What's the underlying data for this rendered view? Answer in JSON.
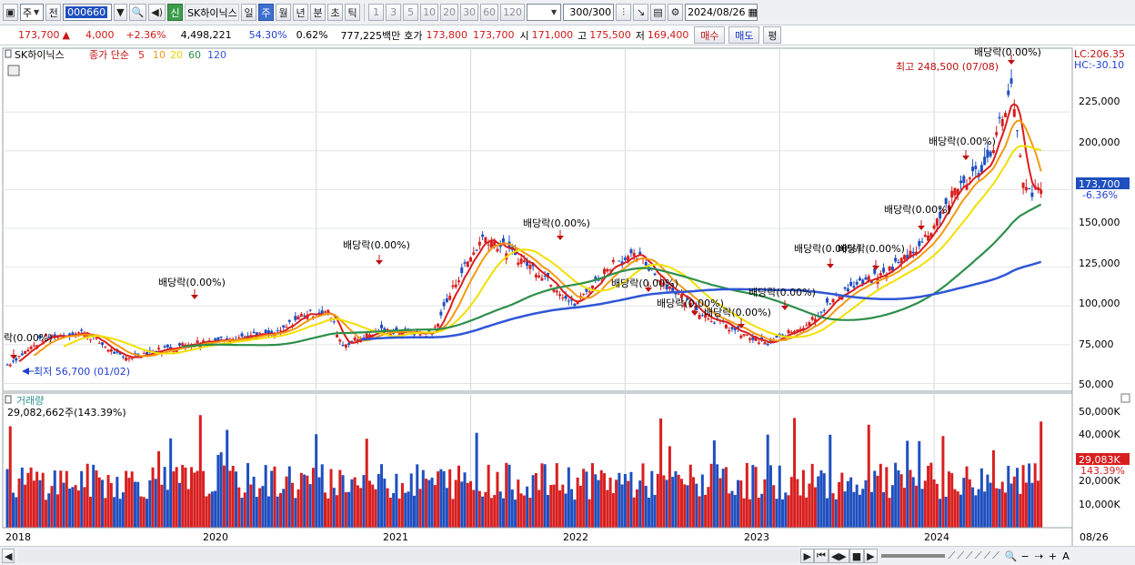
{
  "toolbar": {
    "market": "주",
    "jeon": "전",
    "code": "000660",
    "shin": "신",
    "name": "SK하이닉스",
    "periods": [
      "일",
      "주",
      "월",
      "년",
      "분",
      "초",
      "틱"
    ],
    "selected_period": "주",
    "intervals": [
      "1",
      "3",
      "5",
      "10",
      "20",
      "30",
      "60",
      "120"
    ],
    "count": "300",
    "count_total": "/300",
    "date": "2024/08/26"
  },
  "quote": {
    "price": "173,700",
    "change": "4,000",
    "change_pct": "+2.36%",
    "volume": "4,498,221",
    "ratio": "54.30%",
    "turnover_pct": "0.62%",
    "value": "777,225백만",
    "hoga_label": "호가",
    "ask": "173,800",
    "bid": "173,700",
    "open_label": "시",
    "open": "171,000",
    "high_label": "고",
    "high": "175,500",
    "low_label": "저",
    "low": "169,400",
    "buy_button": "매수",
    "sell_button": "매도",
    "pyeong_button": "평"
  },
  "chart_data": {
    "type": "line",
    "legend": {
      "name": "SK하이닉스",
      "series_label": "종가 단순",
      "ma": [
        "5",
        "10",
        "20",
        "60",
        "120"
      ],
      "ma_colors": [
        "#d81f1f",
        "#f29a12",
        "#f0e000",
        "#2e8f4b",
        "#2f56d6"
      ]
    },
    "x_ticks": [
      "2018",
      "2020",
      "2021",
      "2022",
      "2023",
      "2024",
      "08/26"
    ],
    "y_ticks": [
      "225,000",
      "200,000",
      "175,000",
      "150,000",
      "125,000",
      "100,000",
      "75,000",
      "50,000"
    ],
    "ylim": [
      45000,
      262000
    ],
    "corner_lc": "LC:206.35",
    "corner_hc": "HC:-30.10",
    "current_price_label": "173,700",
    "current_change_label": "-6.36%",
    "annotations": {
      "high": "최고 248,500 (07/08)",
      "low": "최저 56,700 (01/02)",
      "dividend": "배당락(0.00%)",
      "dividend_partial": "락(0.00%)"
    },
    "weekly_close": [
      {
        "x": "2018-01",
        "y": 62000
      },
      {
        "x": "2018-04",
        "y": 80000
      },
      {
        "x": "2018-07",
        "y": 83000
      },
      {
        "x": "2018-10",
        "y": 66000
      },
      {
        "x": "2019-01",
        "y": 72000
      },
      {
        "x": "2019-04",
        "y": 77000
      },
      {
        "x": "2019-07",
        "y": 80000
      },
      {
        "x": "2019-10",
        "y": 82000
      },
      {
        "x": "2019-12",
        "y": 95000
      },
      {
        "x": "2020-02",
        "y": 96000
      },
      {
        "x": "2020-03",
        "y": 75000
      },
      {
        "x": "2020-06",
        "y": 84000
      },
      {
        "x": "2020-10",
        "y": 82000
      },
      {
        "x": "2020-12",
        "y": 118000
      },
      {
        "x": "2021-02",
        "y": 145000
      },
      {
        "x": "2021-04",
        "y": 135000
      },
      {
        "x": "2021-07",
        "y": 118000
      },
      {
        "x": "2021-09",
        "y": 100000
      },
      {
        "x": "2021-12",
        "y": 128000
      },
      {
        "x": "2022-02",
        "y": 132000
      },
      {
        "x": "2022-04",
        "y": 115000
      },
      {
        "x": "2022-07",
        "y": 95000
      },
      {
        "x": "2022-10",
        "y": 82000
      },
      {
        "x": "2022-12",
        "y": 75000
      },
      {
        "x": "2023-03",
        "y": 88000
      },
      {
        "x": "2023-06",
        "y": 110000
      },
      {
        "x": "2023-09",
        "y": 120000
      },
      {
        "x": "2023-12",
        "y": 140000
      },
      {
        "x": "2024-03",
        "y": 178000
      },
      {
        "x": "2024-05",
        "y": 190000
      },
      {
        "x": "2024-07",
        "y": 240000
      },
      {
        "x": "2024-08",
        "y": 173700
      }
    ],
    "volume_panel": {
      "title": "거래량",
      "value_label": "29,082,662주(143.39%)",
      "y_ticks": [
        "50,000K",
        "40,000K",
        "30,000K",
        "20,000K",
        "10,000K"
      ],
      "current_label": "29,083K",
      "current_pct": "143.39%"
    }
  },
  "status": {
    "arrows": "▶ ⏮ ◀▶ ■ ▶"
  }
}
